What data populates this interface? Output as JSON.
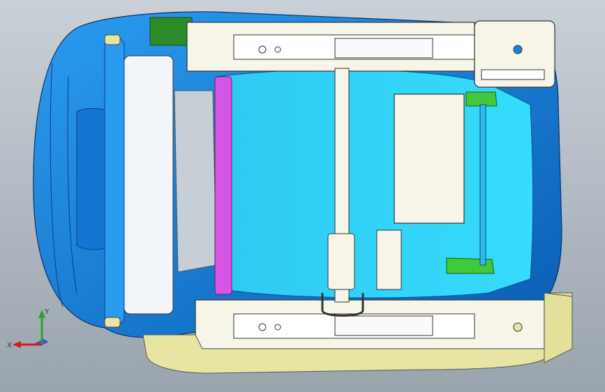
{
  "viewport": {
    "background_top": "#c9d0d8",
    "background_bottom": "#9aa4ad"
  },
  "triad": {
    "x_label": "X",
    "y_label": "Y",
    "x_color": "#d6191c",
    "y_color": "#2aa52a",
    "z_color": "#2f2fd0"
  },
  "model": {
    "colors": {
      "cushion_blue": "#1f8fe3",
      "cushion_dark": "#0c5fb5",
      "pan_cyan": "#33d7f7",
      "frame_white": "#f6f5e8",
      "trim_yellow": "#e8e5a4",
      "bracket_green": "#44c83b",
      "bar_magenta": "#d654e6",
      "block_green": "#2e8b2a"
    }
  }
}
